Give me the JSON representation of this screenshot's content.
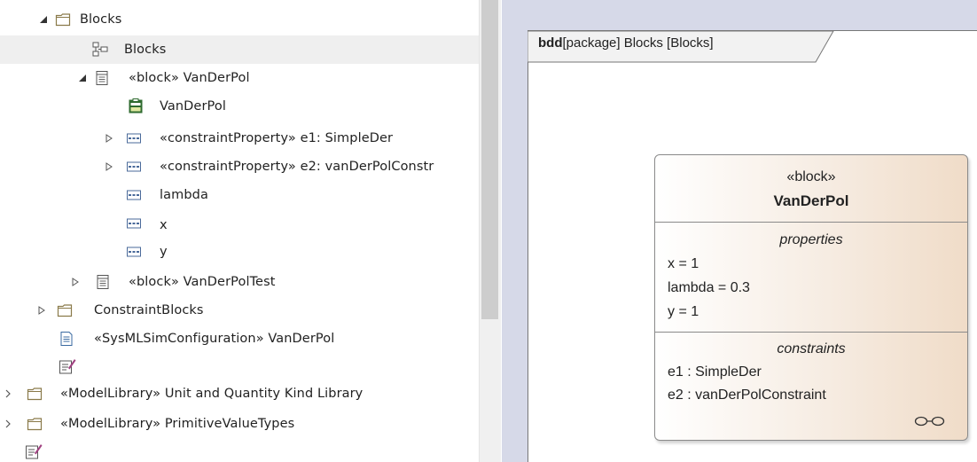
{
  "tree": {
    "items": [
      {
        "label": "Blocks",
        "expanded": true,
        "icon": "package-folder-icon"
      },
      {
        "label": "Blocks",
        "icon": "bdd-diagram-icon"
      },
      {
        "label": "«block» VanDerPol",
        "expanded": true,
        "icon": "block-class-icon"
      },
      {
        "label": "VanDerPol",
        "icon": "block-instance-icon"
      },
      {
        "label": "«constraintProperty» e1: SimpleDer",
        "expanded": false,
        "icon": "property-icon"
      },
      {
        "label": "«constraintProperty» e2: vanDerPolConstr",
        "expanded": false,
        "icon": "property-icon"
      },
      {
        "label": "lambda",
        "icon": "property-icon"
      },
      {
        "label": "x",
        "icon": "property-icon"
      },
      {
        "label": "y",
        "icon": "property-icon"
      },
      {
        "label": "«block» VanDerPolTest",
        "expanded": false,
        "icon": "block-class-icon"
      },
      {
        "label": "ConstraintBlocks",
        "expanded": false,
        "icon": "package-folder-icon"
      },
      {
        "label": "«SysMLSimConfiguration» VanDerPol",
        "icon": "document-icon"
      },
      {
        "label": "",
        "icon": "note-pencil-icon"
      },
      {
        "label": "«ModelLibrary» Unit and Quantity Kind Library",
        "expanded": false,
        "icon": "package-folder-icon"
      },
      {
        "label": "«ModelLibrary» PrimitiveValueTypes",
        "expanded": false,
        "icon": "package-folder-icon"
      },
      {
        "label": "",
        "icon": "note-pencil-icon"
      }
    ]
  },
  "diagram": {
    "frame": {
      "kind": "bdd",
      "rest": "[package] Blocks [Blocks]"
    },
    "block": {
      "stereotype": "«block»",
      "name": "VanDerPol",
      "properties_title": "properties",
      "properties": [
        "x = 1",
        "lambda = 0.3",
        "y = 1"
      ],
      "constraints_title": "constraints",
      "constraints": [
        "e1 : SimpleDer",
        "e2 : vanDerPolConstraint"
      ]
    }
  },
  "colors": {
    "selection": "#efefef",
    "diagram_background": "#d6d9e8",
    "block_fill": "#f0dcc8"
  }
}
